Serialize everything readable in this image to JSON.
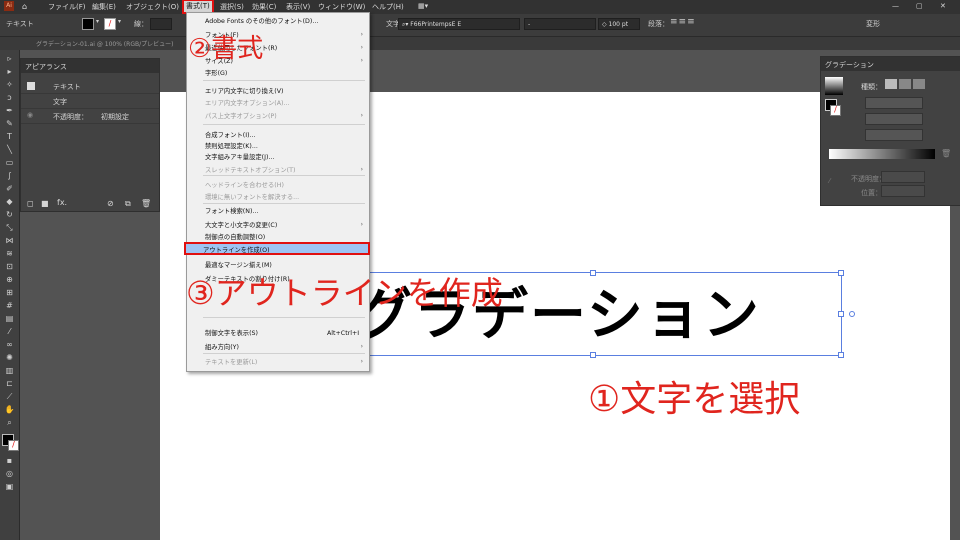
{
  "menubar": {
    "items": [
      "ファイル(F)",
      "編集(E)",
      "オブジェクト(O)",
      "書式(T)",
      "選択(S)",
      "効果(C)",
      "表示(V)",
      "ウィンドウ(W)",
      "ヘルプ(H)"
    ]
  },
  "controlbar": {
    "type_label": "テキスト",
    "stroke_label": "線：",
    "char_label": "文字：",
    "font_name": "F66PrintempsE E",
    "font_style": "-",
    "font_size": "100 pt",
    "para_label": "段落：",
    "transform_label": "変形"
  },
  "tabs": [
    "グラデーション-01.ai @ 100% (RGB/プレビュー)"
  ],
  "appearance": {
    "title": "アピアランス",
    "rows": [
      {
        "label": "テキスト"
      },
      {
        "label": "文字"
      },
      {
        "label": "不透明度：",
        "value": "初期設定"
      }
    ]
  },
  "gradient_panel": {
    "title": "グラデーション",
    "type_label": "種類：",
    "opacity_label": "不透明度：",
    "position_label": "位置："
  },
  "canvas": {
    "text": "グラデーション"
  },
  "type_menu": {
    "items": [
      {
        "label": "Adobe Fonts のその他のフォント(D)...",
        "arrow": false,
        "dis": false
      },
      {
        "label": "フォント(F)",
        "arrow": true,
        "dis": false
      },
      {
        "label": "最近使用したフォント(R)",
        "arrow": true,
        "dis": false
      },
      {
        "label": "サイズ(Z)",
        "arrow": true,
        "dis": false
      },
      {
        "label": "字形(G)",
        "arrow": false,
        "dis": false
      },
      {
        "label": "エリア内文字に切り換え(V)",
        "arrow": false,
        "dis": false
      },
      {
        "label": "エリア内文字オプション(A)...",
        "arrow": false,
        "dis": true
      },
      {
        "label": "パス上文字オプション(P)",
        "arrow": true,
        "dis": true
      },
      {
        "label": "合成フォント(I)...",
        "arrow": false,
        "dis": false
      },
      {
        "label": "禁則処理設定(K)...",
        "arrow": false,
        "dis": false
      },
      {
        "label": "文字組みアキ量設定(J)...",
        "arrow": false,
        "dis": false
      },
      {
        "label": "スレッドテキストオプション(T)",
        "arrow": true,
        "dis": true
      },
      {
        "label": "ヘッドラインを合わせる(H)",
        "arrow": false,
        "dis": true
      },
      {
        "label": "環境に無いフォントを解決する...",
        "arrow": false,
        "dis": true
      },
      {
        "label": "フォント検索(N)...",
        "arrow": false,
        "dis": false
      },
      {
        "label": "大文字と小文字の変更(C)",
        "arrow": true,
        "dis": false
      },
      {
        "label": "制御点の自動調整(O)",
        "arrow": false,
        "dis": false
      },
      {
        "label": "アウトラインを作成(O)",
        "arrow": false,
        "dis": false
      },
      {
        "label": "最適なマージン揃え(M)",
        "arrow": false,
        "dis": false
      },
      {
        "label": "ダミーテキストの割り付け(R)",
        "arrow": false,
        "dis": false
      },
      {
        "label": "制御文字を表示(S)",
        "arrow": false,
        "dis": false,
        "shortcut": "Alt+Ctrl+I"
      },
      {
        "label": "組み方向(Y)",
        "arrow": true,
        "dis": false
      },
      {
        "label": "テキストを更新(L)",
        "arrow": true,
        "dis": true
      }
    ]
  },
  "annotations": {
    "step1": "①文字を選択",
    "step2": "②書式",
    "step3": "③アウトラインを作成"
  },
  "colors": {
    "highlight_red": "#e01010",
    "annotation_red": "#e0251e",
    "selection_blue": "#5a7fe0"
  }
}
